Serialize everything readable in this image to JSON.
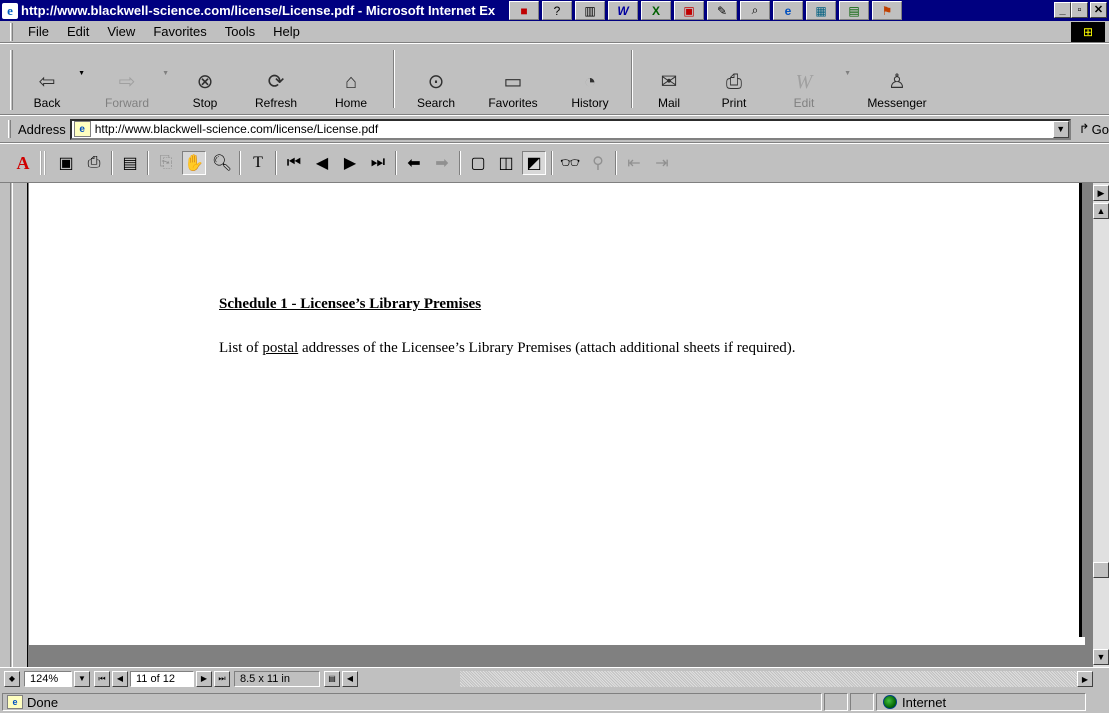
{
  "window": {
    "title": "http://www.blackwell-science.com/license/License.pdf - Microsoft Internet Ex"
  },
  "menu": [
    "File",
    "Edit",
    "View",
    "Favorites",
    "Tools",
    "Help"
  ],
  "toolbar": {
    "back": "Back",
    "forward": "Forward",
    "stop": "Stop",
    "refresh": "Refresh",
    "home": "Home",
    "search": "Search",
    "favorites": "Favorites",
    "history": "History",
    "mail": "Mail",
    "print": "Print",
    "edit": "Edit",
    "messenger": "Messenger"
  },
  "address": {
    "label": "Address",
    "url": "http://www.blackwell-science.com/license/License.pdf",
    "go": "Go"
  },
  "document": {
    "heading": "Schedule 1 - Licensee’s Library Premises",
    "para_pre": "List of ",
    "para_underlined": "postal",
    "para_post": " addresses of the Licensee’s Library Premises (attach additional sheets if required)."
  },
  "acrobat_status": {
    "zoom": "124%",
    "page": "11 of 12",
    "page_size": "8.5 x 11 in"
  },
  "status": {
    "text": "Done",
    "zone": "Internet"
  }
}
